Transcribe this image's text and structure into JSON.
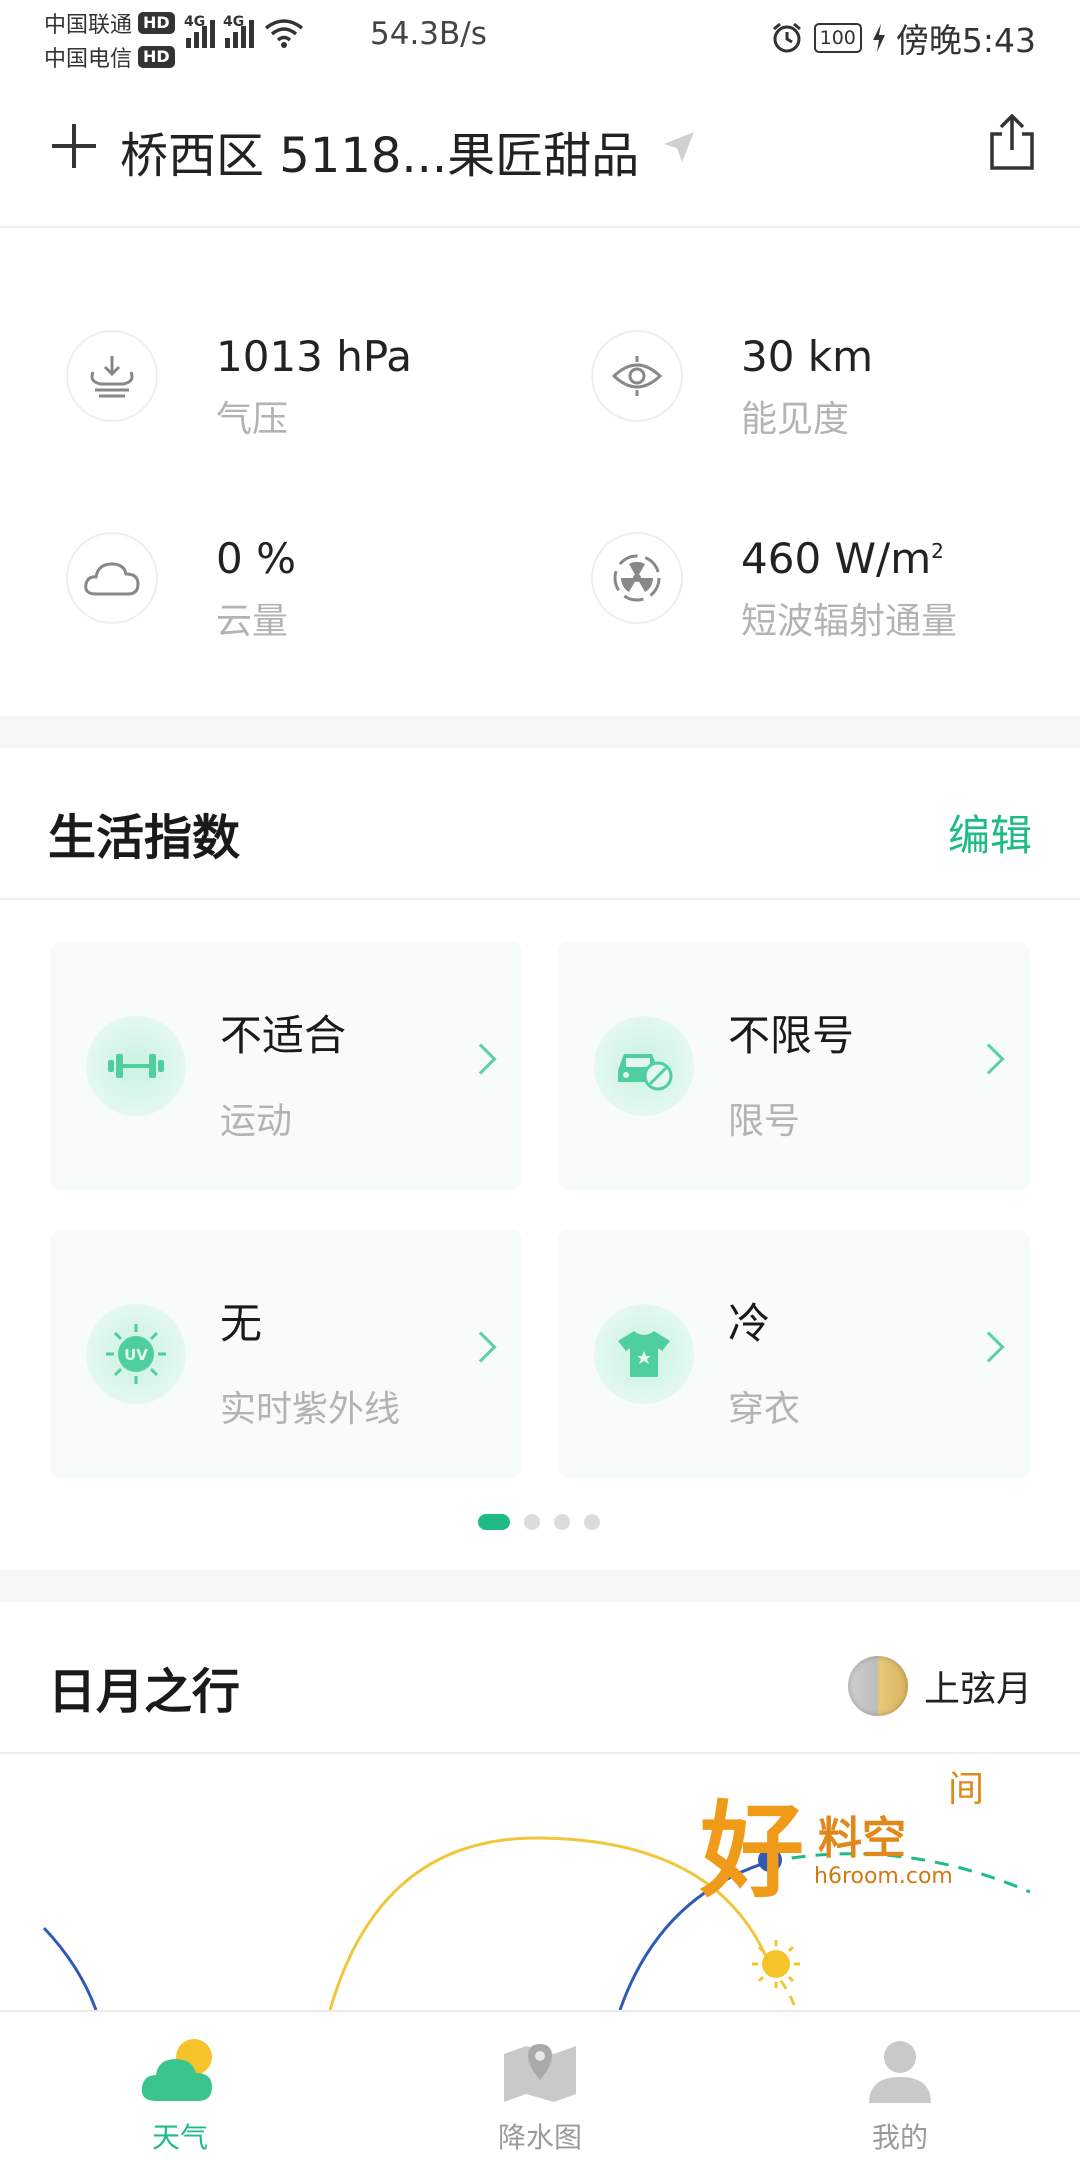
{
  "status_bar": {
    "carrier_1": "中国联通",
    "carrier_2": "中国电信",
    "hd_badge": "HD",
    "network_tag": "4G",
    "net_speed": "54.3B/s",
    "battery": "100",
    "time": "傍晚5:43"
  },
  "header": {
    "location": "桥西区 5118...果匠甜品"
  },
  "details": [
    {
      "value": "1013 hPa",
      "label": "气压",
      "icon": "pressure-icon"
    },
    {
      "value": "30 km",
      "label": "能见度",
      "icon": "visibility-icon"
    },
    {
      "value": "0 %",
      "label": "云量",
      "icon": "cloud-icon"
    },
    {
      "value": "460 W/m",
      "value_sup": "2",
      "label": "短波辐射通量",
      "icon": "radiation-icon"
    }
  ],
  "life_index": {
    "title": "生活指数",
    "edit_label": "编辑",
    "cards": [
      {
        "value": "不适合",
        "label": "运动",
        "icon": "dumbbell-icon"
      },
      {
        "value": "不限号",
        "label": "限号",
        "icon": "car-restriction-icon"
      },
      {
        "value": "无",
        "label": "实时紫外线",
        "icon": "uv-icon"
      },
      {
        "value": "冷",
        "label": "穿衣",
        "icon": "tshirt-icon"
      }
    ],
    "page_count": 4,
    "active_page": 1
  },
  "sun_moon": {
    "title": "日月之行",
    "moon_phase": "上弦月"
  },
  "watermark": {
    "big": "好",
    "mid": "料空",
    "small": "间",
    "url": "h6room.com"
  },
  "bottom_nav": [
    {
      "label": "天气",
      "icon": "weather-icon",
      "active": true
    },
    {
      "label": "降水图",
      "icon": "map-icon",
      "active": false
    },
    {
      "label": "我的",
      "icon": "profile-icon",
      "active": false
    }
  ],
  "colors": {
    "accent": "#1ebc84",
    "card_bg": "#f7fcfa",
    "muted_text": "#b3b3b3",
    "sun_arc": "#f0c63a",
    "moon_arc": "#2f5bb7"
  }
}
